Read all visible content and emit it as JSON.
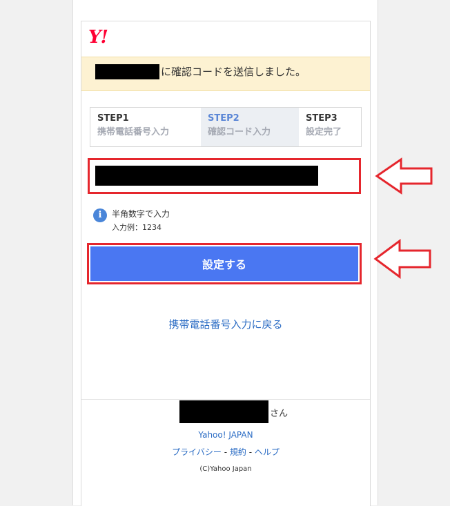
{
  "logo": "Y!",
  "notice": {
    "text": "に確認コードを送信しました。"
  },
  "steps": [
    {
      "title": "STEP1",
      "label": "携帯電話番号入力"
    },
    {
      "title": "STEP2",
      "label": "確認コード入力"
    },
    {
      "title": "STEP3",
      "label": "設定完了"
    }
  ],
  "hint": {
    "icon": "info-icon",
    "line1": "半角数字で入力",
    "line2": "入力例：1234"
  },
  "submit_label": "設定する",
  "back_link": "携帯電話番号入力に戻る",
  "footer": {
    "user_suffix": "さん",
    "yahoo_link": "Yahoo! JAPAN",
    "privacy": "プライバシー",
    "terms": "規約",
    "help": "ヘルプ",
    "sep": " - ",
    "copyright": "(C)Yahoo Japan"
  },
  "colors": {
    "accent": "#4a77f2",
    "highlight": "#e5262d",
    "link": "#2b6cc4",
    "notice_bg": "#fdf2d2"
  }
}
